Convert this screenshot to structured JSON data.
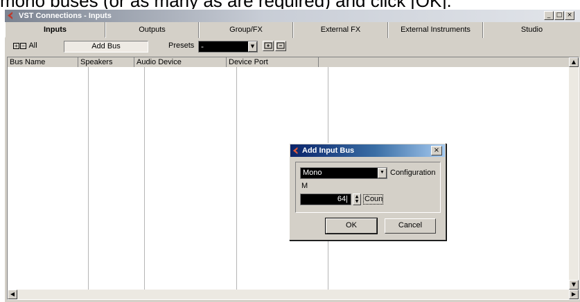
{
  "caption": "mono buses (or as many as are required) and click [OK].",
  "window": {
    "title": "VST Connections - Inputs",
    "minimize": "_",
    "maximize": "□",
    "close": "×"
  },
  "tabs": [
    "Inputs",
    "Outputs",
    "Group/FX",
    "External FX",
    "External Instruments",
    "Studio"
  ],
  "active_tab": "Inputs",
  "toolbar": {
    "expand_label": "All",
    "add_bus_label": "Add Bus",
    "presets_label": "Presets",
    "presets_value": "-"
  },
  "table": {
    "columns": [
      "Bus Name",
      "Speakers",
      "Audio Device",
      "Device Port"
    ]
  },
  "dialog": {
    "title": "Add Input Bus",
    "configuration_value": "Mono",
    "configuration_label": "Configuration",
    "speaker_label": "M",
    "count_value": "64",
    "count_label": "Count",
    "ok_label": "OK",
    "cancel_label": "Cancel"
  },
  "colors": {
    "logo": "#c0392b",
    "dialog_titlebar": "#0a246a",
    "face": "#d4d0c8"
  }
}
